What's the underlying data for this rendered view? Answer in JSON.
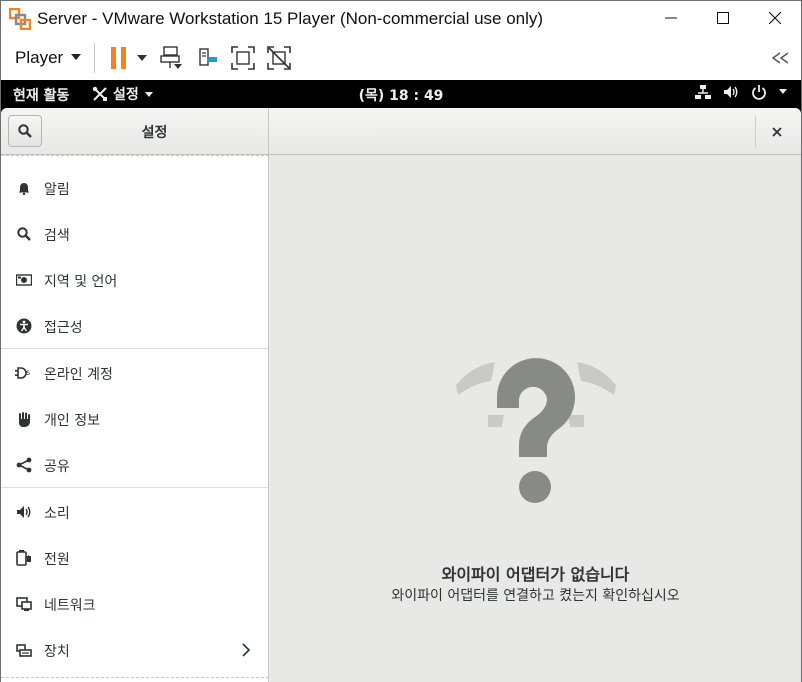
{
  "window": {
    "title": "Server - VMware Workstation 15 Player (Non-commercial use only)",
    "controls": {
      "minimize": "minimize-icon",
      "maximize": "maximize-icon",
      "close": "close-icon"
    }
  },
  "vm_toolbar": {
    "player_label": "Player",
    "buttons": [
      "pause-icon",
      "dropdown-icon",
      "send-ctrl-alt-del-icon",
      "removable-devices-icon",
      "fullscreen-icon",
      "unity-icon"
    ],
    "collapse": "collapse-icon"
  },
  "gnome_topbar": {
    "activities": "현재 활동",
    "app_menu": "설정",
    "clock": "(목) 18 : 49",
    "tray_icons": [
      "network-wired-icon",
      "volume-icon",
      "power-icon"
    ]
  },
  "settings": {
    "header_title": "설정",
    "sidebar_items": [
      {
        "label": "알림",
        "icon": "bell-icon"
      },
      {
        "label": "검색",
        "icon": "search-icon"
      },
      {
        "label": "지역 및 언어",
        "icon": "region-icon"
      },
      {
        "label": "접근성",
        "icon": "accessibility-icon"
      },
      {
        "label": "온라인 계정",
        "icon": "online-accounts-icon"
      },
      {
        "label": "개인 정보",
        "icon": "privacy-hand-icon"
      },
      {
        "label": "공유",
        "icon": "share-icon"
      },
      {
        "label": "소리",
        "icon": "speaker-icon"
      },
      {
        "label": "전원",
        "icon": "power-plug-icon"
      },
      {
        "label": "네트워크",
        "icon": "network-icon"
      },
      {
        "label": "장치",
        "icon": "devices-icon"
      }
    ],
    "main": {
      "empty_title": "와이파이 어댑터가 없습니다",
      "empty_subtitle": "와이파이 어댑터를 연결하고 켰는지 확인하십시오"
    }
  },
  "colors": {
    "vm_accent": "#f58220",
    "topbar_bg": "#000000",
    "headerbar_bg": "#ececec",
    "main_bg": "#e8e8e7",
    "placeholder_icon": "#888a85"
  }
}
